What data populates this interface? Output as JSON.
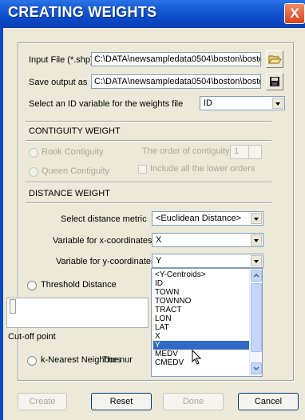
{
  "window": {
    "title": "CREATING WEIGHTS",
    "close_glyph": "X"
  },
  "input_file": {
    "label": "Input File (*.shp)",
    "value": "C:\\DATA\\newsampledata0504\\boston\\bosto",
    "button_icon": "open-folder-icon"
  },
  "save_output": {
    "label": "Save output as",
    "value": "C:\\DATA\\newsampledata0504\\boston\\bosto",
    "button_icon": "save-disk-icon"
  },
  "id_variable": {
    "label": "Select an ID variable for the weights file",
    "value": "ID"
  },
  "contiguity": {
    "heading": "CONTIGUITY WEIGHT",
    "rook_label": "Rook Contiguity",
    "queen_label": "Queen Contiguity",
    "order_label": "The order of contiguity",
    "order_value": "1",
    "include_lower_label": "Include all the lower orders"
  },
  "distance": {
    "heading": "DISTANCE WEIGHT",
    "metric_label": "Select distance metric",
    "metric_value": "<Euclidean Distance>",
    "x_label": "Variable for x-coordinates",
    "x_value": "X",
    "y_label": "Variable for y-coordinates",
    "y_value": "Y",
    "threshold_label": "Threshold Distance",
    "cutoff_label": "Cut-off point",
    "knn_label": "k-Nearest Neighbors",
    "knn_number_label": "The nur"
  },
  "dropdown_list": {
    "items": [
      "<Y-Centroids>",
      "ID",
      "TOWN",
      "TOWNNO",
      "TRACT",
      "LON",
      "LAT",
      "X",
      "Y",
      "MEDV",
      "CMEDV"
    ],
    "selected": "Y"
  },
  "buttons": {
    "create": "Create",
    "reset": "Reset",
    "done": "Done",
    "cancel": "Cancel"
  },
  "colors": {
    "title_blue": "#0a49c5",
    "close_red": "#d8431c",
    "selection": "#316ac5"
  }
}
